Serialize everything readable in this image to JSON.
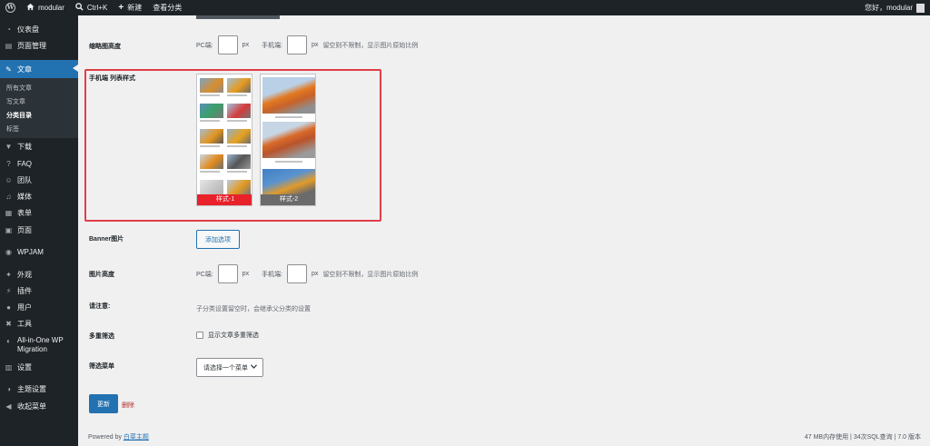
{
  "adminbar": {
    "site_name": "modular",
    "shortcut": "Ctrl+K",
    "new_label": "新建",
    "view_label": "查看分类",
    "greeting": "您好，modular"
  },
  "sidebar": {
    "items": [
      {
        "label": "仪表盘",
        "icon": "dashboard-icon"
      },
      {
        "label": "页面管理",
        "icon": "page-manage-icon"
      },
      {
        "label": "文章",
        "icon": "pin-icon"
      },
      {
        "label": "下载",
        "icon": "download-icon"
      },
      {
        "label": "FAQ",
        "icon": "faq-icon"
      },
      {
        "label": "团队",
        "icon": "team-icon"
      },
      {
        "label": "媒体",
        "icon": "media-icon"
      },
      {
        "label": "表单",
        "icon": "form-icon"
      },
      {
        "label": "页面",
        "icon": "pages-icon"
      },
      {
        "label": "WPJAM",
        "icon": "wpjam-icon"
      },
      {
        "label": "外观",
        "icon": "appearance-icon"
      },
      {
        "label": "插件",
        "icon": "plugin-icon"
      },
      {
        "label": "用户",
        "icon": "users-icon"
      },
      {
        "label": "工具",
        "icon": "tools-icon"
      },
      {
        "label": "All-in-One WP Migration",
        "icon": "migration-icon"
      },
      {
        "label": "设置",
        "icon": "settings-icon"
      },
      {
        "label": "主题设置",
        "icon": "theme-settings-icon"
      },
      {
        "label": "收起菜单",
        "icon": "collapse-icon"
      }
    ],
    "submenu": [
      "所有文章",
      "写文章",
      "分类目录",
      "标签"
    ]
  },
  "form": {
    "thumb_height": {
      "label": "缩略图高度",
      "pc_label": "PC端:",
      "mobile_label": "手机端:",
      "unit": "px",
      "hint": "留空则不限制，显示图片原始比例"
    },
    "mobile_list_style": {
      "label": "手机端 列表样式",
      "options": [
        "样式-1",
        "样式-2"
      ],
      "option_colors": [
        "#e8212a",
        "#6b6b6b"
      ]
    },
    "banner": {
      "label": "Banner图片",
      "button": "添加选项"
    },
    "image_height": {
      "label": "图片高度",
      "pc_label": "PC端:",
      "mobile_label": "手机端:",
      "unit": "px",
      "hint": "留空则不限制，显示图片原始比例"
    },
    "notice": {
      "label": "请注意:",
      "text": "子分类设置留空时，会继承父分类的设置"
    },
    "multi_filter": {
      "label": "多重筛选",
      "checkbox_label": "显示文章多重筛选"
    },
    "filter_menu": {
      "label": "筛选菜单",
      "selected": "请选择一个菜单"
    },
    "update_button": "更新",
    "delete_link": "删除"
  },
  "footer": {
    "powered_by": "Powered by",
    "theme_link": "白菜主题",
    "stats": "47 MB内存使用 | 34次SQL查询 | 7.0 版本"
  }
}
